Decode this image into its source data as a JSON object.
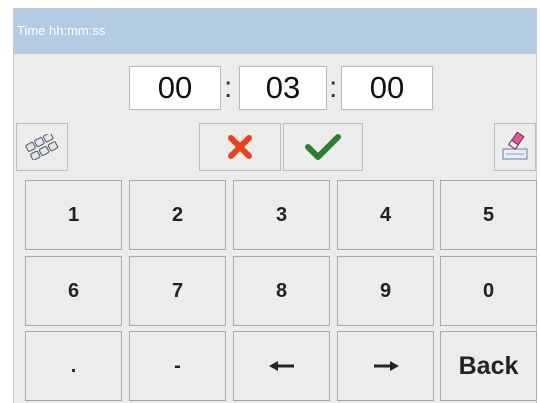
{
  "title": "Time hh:mm:ss",
  "time": {
    "hours": "00",
    "minutes": "03",
    "seconds": "00",
    "separator": ":"
  },
  "tools": {
    "keyboard_icon": "keyboard-icon",
    "cancel_icon": "cross-icon",
    "confirm_icon": "check-icon",
    "clear_icon": "eraser-icon"
  },
  "colors": {
    "title_bar": "#b3cce3",
    "cancel": "#e8441b",
    "confirm": "#2e7d32"
  },
  "keypad": {
    "k1": "1",
    "k2": "2",
    "k3": "3",
    "k4": "4",
    "k5": "5",
    "k6": "6",
    "k7": "7",
    "k8": "8",
    "k9": "9",
    "k0": "0",
    "dot": ".",
    "minus": "-",
    "back": "Back"
  }
}
